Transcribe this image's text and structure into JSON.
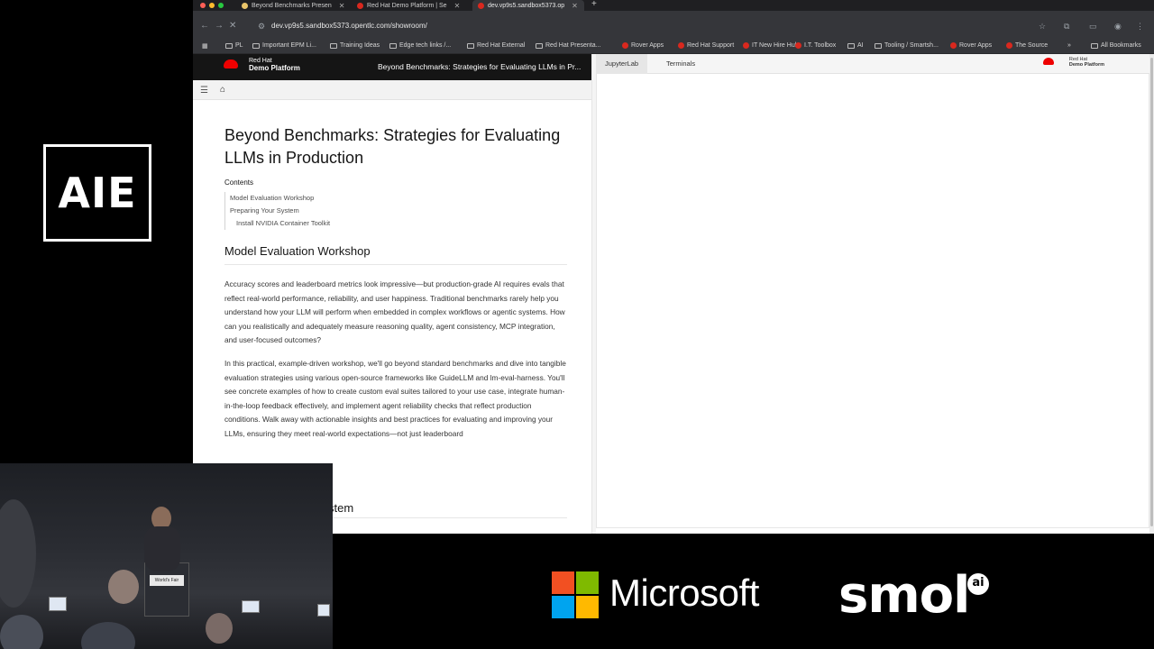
{
  "event_logo": {
    "text": "AIE"
  },
  "browser": {
    "tabs": [
      {
        "label": "Beyond Benchmarks Presen",
        "color": "#e9c46a"
      },
      {
        "label": "Red Hat Demo Platform | Se",
        "color": "#d9281e"
      },
      {
        "label": "dev.vp9s5.sandbox5373.op",
        "color": "#d9281e"
      }
    ],
    "new_tab": "+",
    "url": "dev.vp9s5.sandbox5373.opentlc.com/showroom/",
    "bookmarks": [
      {
        "label": "PL",
        "type": "folder"
      },
      {
        "label": "Important EPM Li...",
        "type": "folder"
      },
      {
        "label": "Training Ideas",
        "type": "folder"
      },
      {
        "label": "Edge tech links /...",
        "type": "folder"
      },
      {
        "label": "Red Hat External",
        "type": "folder"
      },
      {
        "label": "Red Hat Presenta...",
        "type": "folder"
      },
      {
        "label": "Rover Apps",
        "type": "redhat"
      },
      {
        "label": "Red Hat Support",
        "type": "redhat"
      },
      {
        "label": "IT New Hire Hub",
        "type": "redhat"
      },
      {
        "label": "I.T. Toolbox",
        "type": "redhat"
      },
      {
        "label": "AI",
        "type": "folder"
      },
      {
        "label": "Tooling / Smartsh...",
        "type": "folder"
      },
      {
        "label": "Rover Apps",
        "type": "redhat"
      },
      {
        "label": "The Source",
        "type": "redhat"
      }
    ],
    "overflow": "»",
    "all_bookmarks": "All Bookmarks"
  },
  "showroom": {
    "brand_line1": "Red Hat",
    "brand_line2": "Demo Platform",
    "header_title": "Beyond Benchmarks: Strategies for Evaluating LLMs in Pr...",
    "doc_title": "Beyond Benchmarks: Strategies for Evaluating LLMs in Production",
    "contents_label": "Contents",
    "toc": [
      {
        "label": "Model Evaluation Workshop",
        "sub": false
      },
      {
        "label": "Preparing Your System",
        "sub": false
      },
      {
        "label": "Install NVIDIA Container Toolkit",
        "sub": true
      }
    ],
    "section_heading": "Model Evaluation Workshop",
    "paragraphs": [
      "Accuracy scores and leaderboard metrics look impressive—but production-grade AI requires evals that reflect real-world performance, reliability, and user happiness. Traditional benchmarks rarely help you understand how your LLM will perform when embedded in complex workflows or agentic systems. How can you realistically and adequately measure reasoning quality, agent consistency, MCP integration, and user-focused outcomes?",
      "In this practical, example-driven workshop, we'll go beyond standard benchmarks and dive into tangible evaluation strategies using various open-source frameworks like GuideLLM and lm-eval-harness. You'll see concrete examples of how to create custom eval suites tailored to your use case, integrate human-in-the-loop feedback effectively, and implement agent reliability checks that reflect production conditions. Walk away with actionable insights and best practices for evaluating and improving your LLMs, ensuring they meet real-world expectations—not just leaderboard"
    ],
    "partial_heading": "stem",
    "right_tabs": [
      "JupyterLab",
      "Terminals"
    ],
    "mini_brand_line1": "Red Hat",
    "mini_brand_line2": "Demo Platform"
  },
  "camera": {
    "podium_sign": "World's Fair"
  },
  "sponsors": {
    "microsoft": "Microsoft",
    "smol": "smol",
    "smol_badge": "ai"
  },
  "colors": {
    "redhat_red": "#ee0000",
    "header_dark": "#151515"
  }
}
